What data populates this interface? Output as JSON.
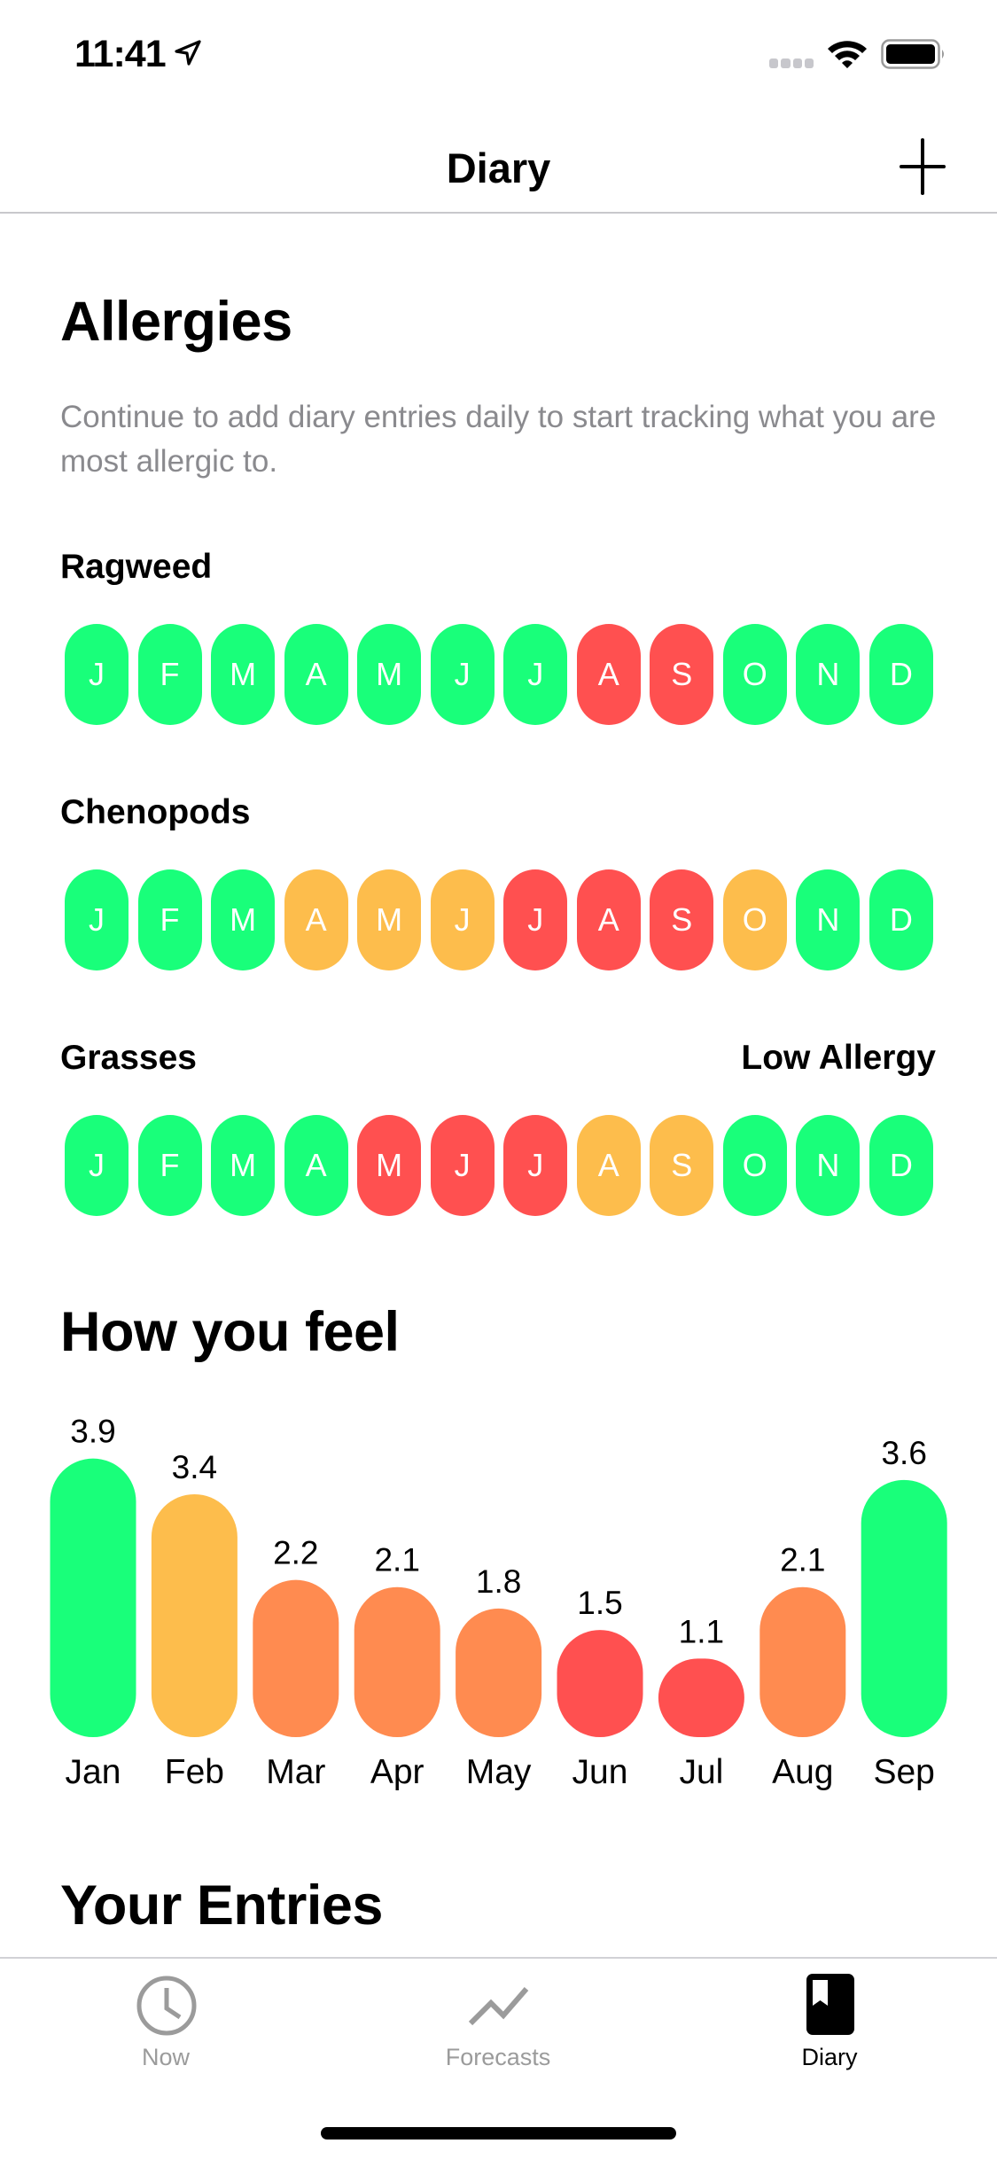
{
  "status_bar": {
    "time": "11:41",
    "location_icon": "location-arrow-icon",
    "signal_icon": "cellular-signal-icon",
    "wifi_icon": "wifi-icon",
    "battery_icon": "battery-icon"
  },
  "nav": {
    "title": "Diary",
    "add_icon": "plus-icon"
  },
  "allergies": {
    "title": "Allergies",
    "subtitle": "Continue to add diary entries daily to start tracking what you are most allergic to.",
    "level_label": "Low Allergy",
    "colors": {
      "low": "#19FF7A",
      "medium": "#FDBD4C",
      "high": "#FF5050"
    },
    "allergens": [
      {
        "name": "Ragweed",
        "months": [
          {
            "letter": "J",
            "level": "low"
          },
          {
            "letter": "F",
            "level": "low"
          },
          {
            "letter": "M",
            "level": "low"
          },
          {
            "letter": "A",
            "level": "low"
          },
          {
            "letter": "M",
            "level": "low"
          },
          {
            "letter": "J",
            "level": "low"
          },
          {
            "letter": "J",
            "level": "low"
          },
          {
            "letter": "A",
            "level": "high"
          },
          {
            "letter": "S",
            "level": "high"
          },
          {
            "letter": "O",
            "level": "low"
          },
          {
            "letter": "N",
            "level": "low"
          },
          {
            "letter": "D",
            "level": "low"
          }
        ]
      },
      {
        "name": "Chenopods",
        "months": [
          {
            "letter": "J",
            "level": "low"
          },
          {
            "letter": "F",
            "level": "low"
          },
          {
            "letter": "M",
            "level": "low"
          },
          {
            "letter": "A",
            "level": "medium"
          },
          {
            "letter": "M",
            "level": "medium"
          },
          {
            "letter": "J",
            "level": "medium"
          },
          {
            "letter": "J",
            "level": "high"
          },
          {
            "letter": "A",
            "level": "high"
          },
          {
            "letter": "S",
            "level": "high"
          },
          {
            "letter": "O",
            "level": "medium"
          },
          {
            "letter": "N",
            "level": "low"
          },
          {
            "letter": "D",
            "level": "low"
          }
        ]
      },
      {
        "name": "Grasses",
        "months": [
          {
            "letter": "J",
            "level": "low"
          },
          {
            "letter": "F",
            "level": "low"
          },
          {
            "letter": "M",
            "level": "low"
          },
          {
            "letter": "A",
            "level": "low"
          },
          {
            "letter": "M",
            "level": "high"
          },
          {
            "letter": "J",
            "level": "high"
          },
          {
            "letter": "J",
            "level": "high"
          },
          {
            "letter": "A",
            "level": "medium"
          },
          {
            "letter": "S",
            "level": "medium"
          },
          {
            "letter": "O",
            "level": "low"
          },
          {
            "letter": "N",
            "level": "low"
          },
          {
            "letter": "D",
            "level": "low"
          }
        ]
      }
    ]
  },
  "feel": {
    "title": "How you feel"
  },
  "chart_data": {
    "type": "bar",
    "title": "How you feel",
    "xlabel": "",
    "ylabel": "",
    "categories": [
      "Jan",
      "Feb",
      "Mar",
      "Apr",
      "May",
      "Jun",
      "Jul",
      "Aug",
      "Sep"
    ],
    "values": [
      3.9,
      3.4,
      2.2,
      2.1,
      1.8,
      1.5,
      1.1,
      2.1,
      3.6
    ],
    "data_labels": [
      "3.9",
      "3.4",
      "2.2",
      "2.1",
      "1.8",
      "1.5",
      "1.1",
      "2.1",
      "3.6"
    ],
    "bar_colors": [
      "#19FF7A",
      "#FDBD4C",
      "#FF8B50",
      "#FF8B50",
      "#FF8B50",
      "#FF5050",
      "#FF5050",
      "#FF8B50",
      "#19FF7A"
    ],
    "ylim": [
      0,
      3.9
    ],
    "grid": false,
    "legend": "none"
  },
  "entries": {
    "title": "Your Entries"
  },
  "tab_bar": {
    "tabs": [
      {
        "label": "Now",
        "icon": "clock-icon",
        "selected": false,
        "color": "#9B9B9B"
      },
      {
        "label": "Forecasts",
        "icon": "trend-line-icon",
        "selected": false,
        "color": "#9B9B9B"
      },
      {
        "label": "Diary",
        "icon": "book-icon",
        "selected": true,
        "color": "#000000"
      }
    ]
  }
}
